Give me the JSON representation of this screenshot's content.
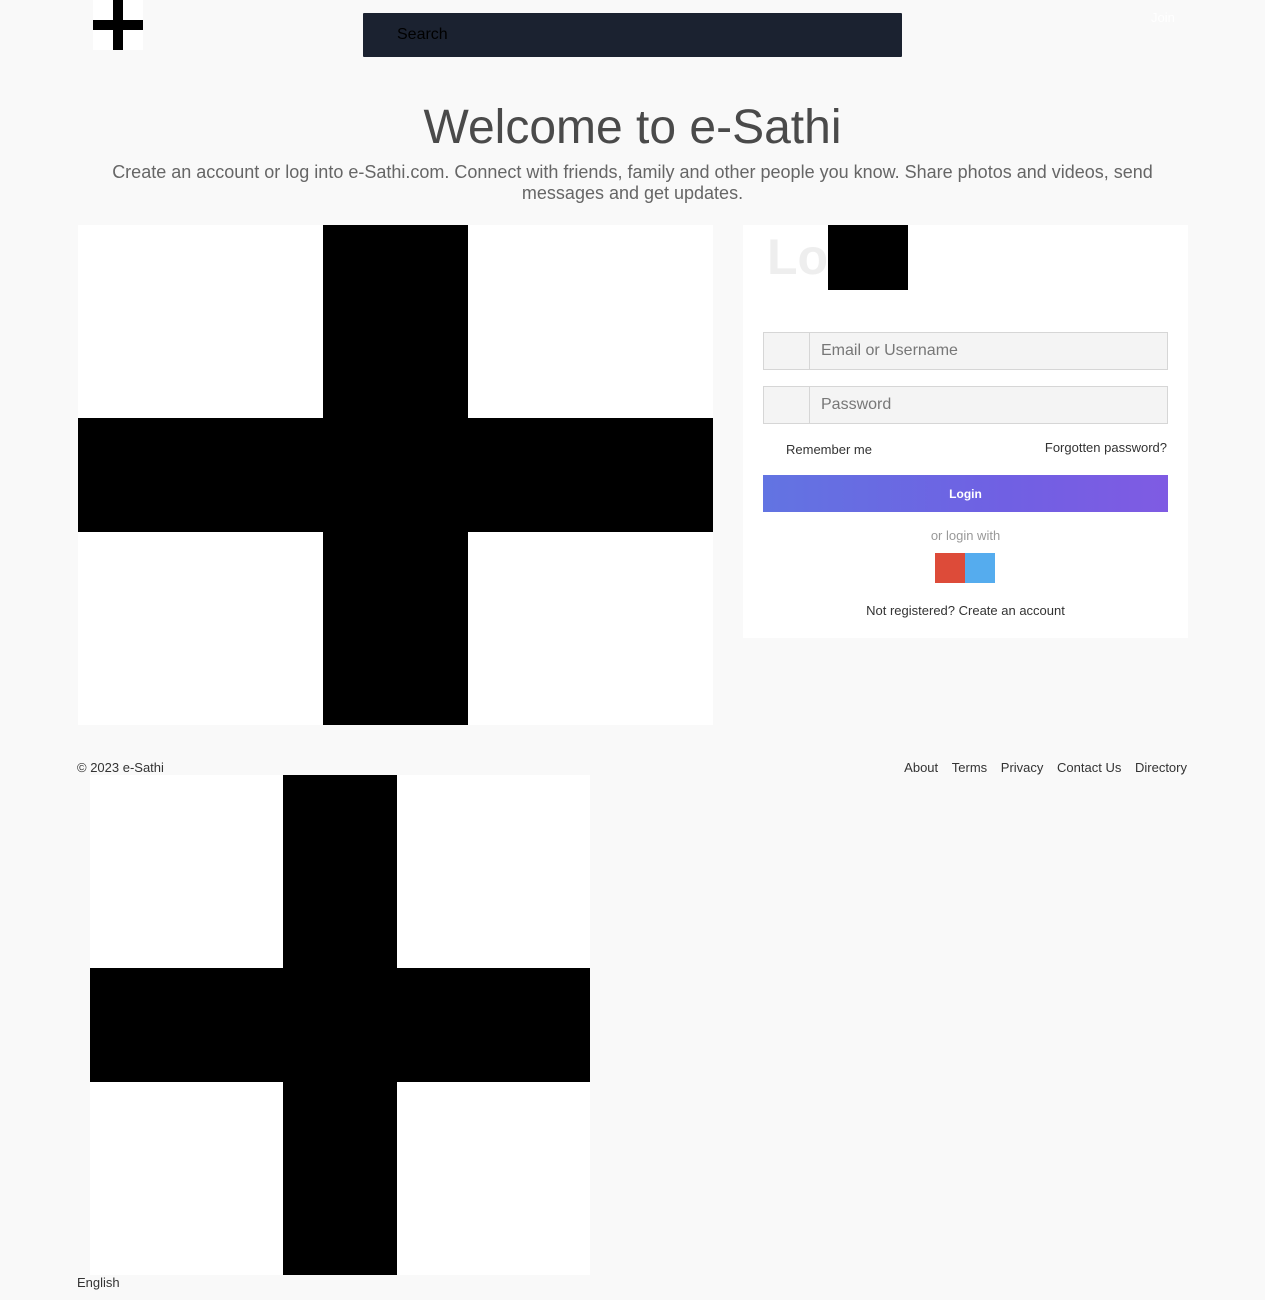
{
  "header": {
    "search_placeholder": "Search",
    "top_link": "Join"
  },
  "hero": {
    "title": "Welcome to e-Sathi",
    "subtitle": "Create an account or log into e-Sathi.com. Connect with friends, family and other people you know. Share photos and videos, send messages and get updates."
  },
  "login": {
    "title": "Login",
    "email_placeholder": "Email or Username",
    "password_placeholder": "Password",
    "remember_label": "Remember me",
    "forgot_label": "Forgotten password?",
    "button_label": "Login",
    "or_login_with": "or login with",
    "social": [
      {
        "icon": "google-icon",
        "color": "#dd4b39"
      },
      {
        "icon": "twitter-icon",
        "color": "#55acee"
      }
    ],
    "register_text": "Not registered? Create an account"
  },
  "footer": {
    "copyright": "© 2023 e-Sathi",
    "links": [
      "About",
      "Terms",
      "Privacy",
      "Contact Us",
      "Directory"
    ],
    "language": "English"
  },
  "colors": {
    "search_bg": "#1b2230",
    "button_gradient_start": "#6274e2",
    "button_gradient_end": "#7f5be3"
  }
}
